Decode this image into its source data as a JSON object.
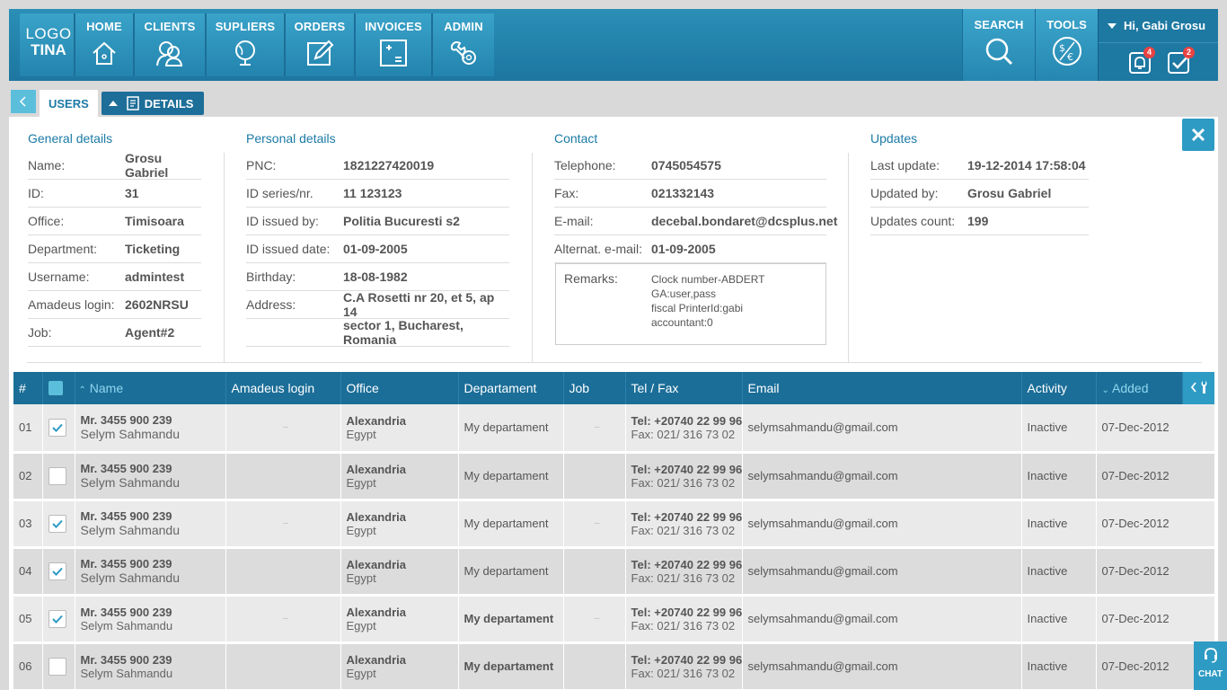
{
  "logo": {
    "line1": "LOGO",
    "line2": "TINA"
  },
  "nav": [
    {
      "label": "HOME",
      "icon": "home-icon"
    },
    {
      "label": "CLIENTS",
      "icon": "clients-icon"
    },
    {
      "label": "SUPLIERS",
      "icon": "globe-icon"
    },
    {
      "label": "ORDERS",
      "icon": "edit-icon"
    },
    {
      "label": "INVOICES",
      "icon": "calculator-icon"
    },
    {
      "label": "ADMIN",
      "icon": "tools-icon"
    }
  ],
  "right_nav": {
    "search": "SEARCH",
    "tools": "TOOLS"
  },
  "user": {
    "greeting": "Hi, Gabi Grosu",
    "notifications": "4",
    "tasks": "2"
  },
  "tabs": {
    "users": "USERS",
    "details": "DETAILS"
  },
  "general": {
    "title": "General details",
    "rows": [
      {
        "k": "Name:",
        "v": "Grosu Gabriel"
      },
      {
        "k": "ID:",
        "v": "31"
      },
      {
        "k": "Office:",
        "v": "Timisoara"
      },
      {
        "k": "Department:",
        "v": "Ticketing"
      },
      {
        "k": "Username:",
        "v": "admintest"
      },
      {
        "k": "Amadeus login:",
        "v": "2602NRSU"
      },
      {
        "k": "Job:",
        "v": "Agent#2"
      }
    ]
  },
  "personal": {
    "title": "Personal details",
    "rows": [
      {
        "k": "PNC:",
        "v": "1821227420019"
      },
      {
        "k": "ID series/nr.",
        "v": "11 123123"
      },
      {
        "k": "ID issued by:",
        "v": "Politia Bucuresti s2"
      },
      {
        "k": "ID issued date:",
        "v": "01-09-2005"
      },
      {
        "k": "Birthday:",
        "v": "18-08-1982"
      },
      {
        "k": "Address:",
        "v": "C.A Rosetti nr 20, et 5, ap 14"
      },
      {
        "k": "",
        "v": "sector 1, Bucharest, Romania"
      }
    ]
  },
  "contact": {
    "title": "Contact",
    "rows": [
      {
        "k": "Telephone:",
        "v": "0745054575"
      },
      {
        "k": "Fax:",
        "v": "021332143"
      },
      {
        "k": "E-mail:",
        "v": "decebal.bondaret@dcsplus.net"
      },
      {
        "k": "Alternat. e-mail:",
        "v": "01-09-2005"
      }
    ],
    "remarks_label": "Remarks:",
    "remarks": [
      "Clock number-ABDERT",
      "GA:user,pass",
      "fiscal PrinterId:gabi",
      "accountant:0"
    ]
  },
  "updates": {
    "title": "Updates",
    "rows": [
      {
        "k": "Last update:",
        "v": "19-12-2014 17:58:04"
      },
      {
        "k": "Updated by:",
        "v": "Grosu Gabriel"
      },
      {
        "k": "Updates count:",
        "v": "199"
      }
    ]
  },
  "table": {
    "headers": {
      "num": "#",
      "name": "Name",
      "amadeus": "Amadeus login",
      "office": "Office",
      "dept": "Departament",
      "job": "Job",
      "tel": "Tel / Fax",
      "email": "Email",
      "activity": "Activity",
      "added": "Added"
    },
    "rows": [
      {
        "num": "01",
        "checked": true,
        "name1": "Mr. 3455 900 239",
        "name2": "Selym Sahmandu",
        "amadeus": "–",
        "office1": "Alexandria",
        "office2": "Egypt",
        "dept": "My departament",
        "job": "–",
        "tel": "Tel: +20740 22 99 96",
        "fax": "Fax: 021/ 316 73 02",
        "email": "selymsahmandu@gmail.com",
        "activity": "Inactive",
        "added": "07-Dec-2012"
      },
      {
        "num": "02",
        "checked": false,
        "name1": "Mr. 3455 900 239",
        "name2": "Selym Sahmandu",
        "amadeus": "",
        "office1": "Alexandria",
        "office2": "Egypt",
        "dept": "My departament",
        "job": "",
        "tel": "Tel: +20740 22 99 96",
        "fax": "Fax: 021/ 316 73 02",
        "email": "selymsahmandu@gmail.com",
        "activity": "Inactive",
        "added": "07-Dec-2012"
      },
      {
        "num": "03",
        "checked": true,
        "name1": "Mr. 3455 900 239",
        "name2": "Selym Sahmandu",
        "amadeus": "–",
        "office1": "Alexandria",
        "office2": "Egypt",
        "dept": "My departament",
        "job": "–",
        "tel": "Tel: +20740 22 99 96",
        "fax": "Fax: 021/ 316 73 02",
        "email": "selymsahmandu@gmail.com",
        "activity": "Inactive",
        "added": "07-Dec-2012"
      },
      {
        "num": "04",
        "checked": true,
        "name1": "Mr. 3455 900 239",
        "name2": "Selym Sahmandu",
        "amadeus": "",
        "office1": "Alexandria",
        "office2": "Egypt",
        "dept": "My departament",
        "job": "",
        "tel": "Tel: +20740 22 99 96",
        "fax": "Fax: 021/ 316 73 02",
        "email": "selymsahmandu@gmail.com",
        "activity": "Inactive",
        "added": "07-Dec-2012"
      },
      {
        "num": "05",
        "checked": true,
        "name1": "Mr. 3455 900 239",
        "name2": "Selym Sahmandu",
        "amadeus": "–",
        "office1": "Alexandria",
        "office2": "Egypt",
        "dept": "My departament",
        "job": "–",
        "tel": "Tel: +20740 22 99 96",
        "fax": "Fax: 021/ 316 73 02",
        "email": "selymsahmandu@gmail.com",
        "activity": "Inactive",
        "added": "07-Dec-2012"
      },
      {
        "num": "06",
        "checked": false,
        "name1": "Mr. 3455 900 239",
        "name2": "Selym Sahmandu",
        "amadeus": "",
        "office1": "Alexandria",
        "office2": "Egypt",
        "dept": "My departament",
        "job": "",
        "tel": "Tel: +20740 22 99 96",
        "fax": "Fax: 021/ 316 73 02",
        "email": "selymsahmandu@gmail.com",
        "activity": "Inactive",
        "added": "07-Dec-2012"
      }
    ]
  },
  "chat": "CHAT",
  "colors": {
    "accent": "#2e9bc4",
    "header_dark": "#1b6e98"
  }
}
